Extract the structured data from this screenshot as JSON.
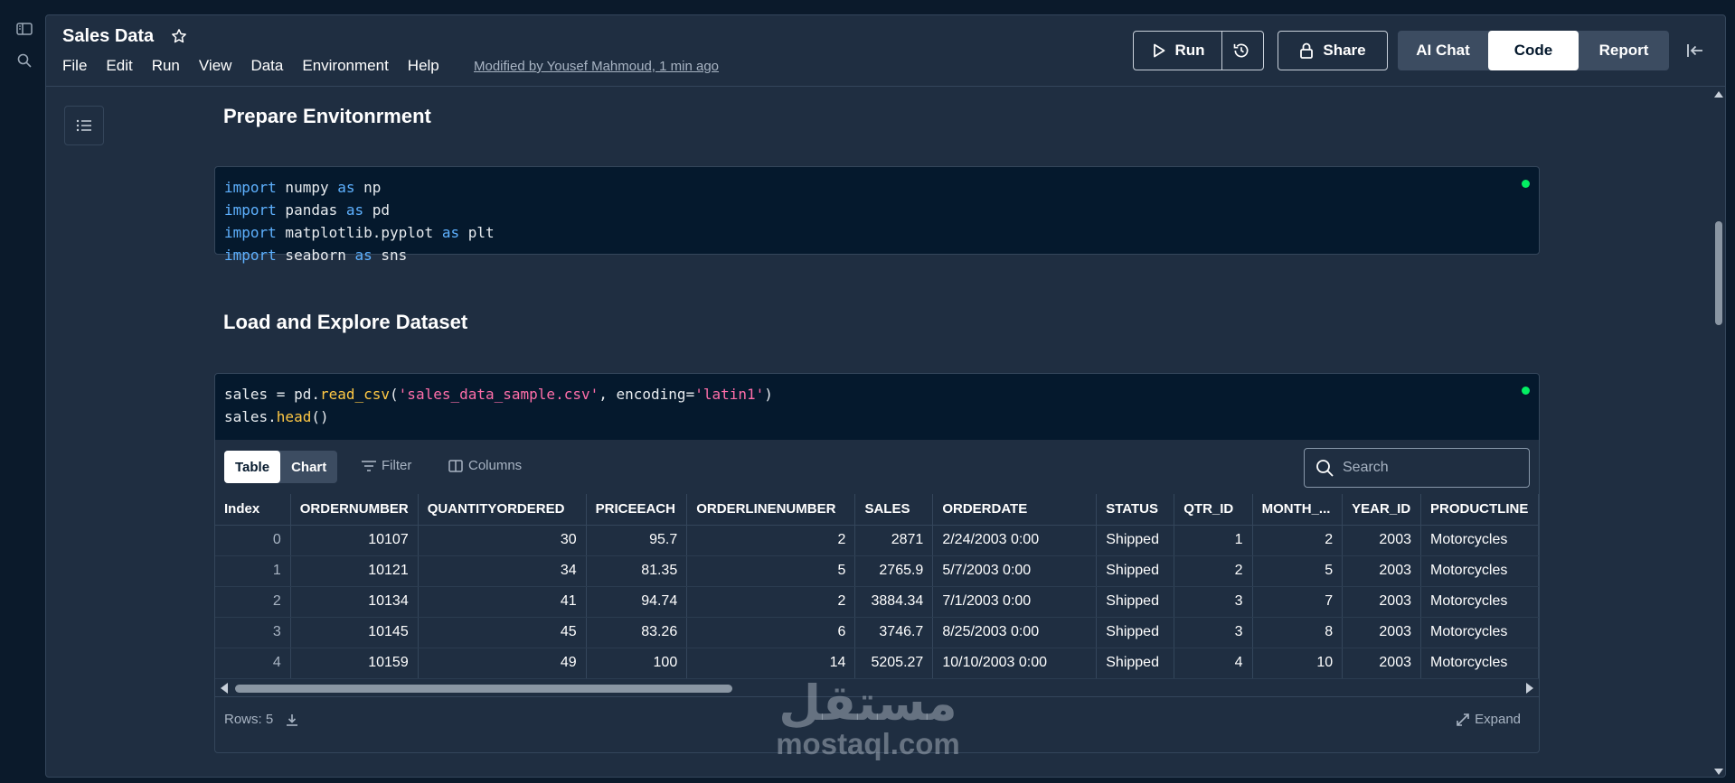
{
  "header": {
    "title": "Sales Data",
    "menu": [
      "File",
      "Edit",
      "Run",
      "View",
      "Data",
      "Environment",
      "Help"
    ],
    "modified": "Modified by Yousef Mahmoud, 1 min ago",
    "run_label": "Run",
    "share_label": "Share",
    "modes": [
      "AI Chat",
      "Code",
      "Report"
    ],
    "active_mode": "Code"
  },
  "sections": {
    "env_heading": "Prepare Envitonrment",
    "load_heading": "Load and Explore Dataset"
  },
  "cell1": {
    "lines": [
      [
        "import",
        " numpy ",
        "as",
        " np"
      ],
      [
        "import",
        " pandas ",
        "as",
        " pd"
      ],
      [
        "import",
        " matplotlib.pyplot ",
        "as",
        " plt"
      ],
      [
        "import",
        " seaborn ",
        "as",
        " sns"
      ]
    ]
  },
  "cell2": {
    "line1": {
      "a": "sales = pd.",
      "fn": "read_csv",
      "b": "(",
      "s1": "'sales_data_sample.csv'",
      "c": ", encoding=",
      "s2": "'latin1'",
      "d": ")"
    },
    "line2": {
      "a": "sales.",
      "fn": "head",
      "b": "()"
    }
  },
  "output": {
    "tabs": [
      "Table",
      "Chart"
    ],
    "active_tab": "Table",
    "filter_label": "Filter",
    "columns_label": "Columns",
    "search_placeholder": "Search",
    "rows_label": "Rows: 5",
    "expand_label": "Expand",
    "table": {
      "headers": [
        "Index",
        "ORDERNUMBER",
        "QUANTITYORDERED",
        "PRICEEACH",
        "ORDERLINENUMBER",
        "SALES",
        "ORDERDATE",
        "STATUS",
        "QTR_ID",
        "MONTH_...",
        "YEAR_ID",
        "PRODUCTLINE"
      ],
      "rows": [
        [
          "0",
          "10107",
          "30",
          "95.7",
          "2",
          "2871",
          "2/24/2003 0:00",
          "Shipped",
          "1",
          "2",
          "2003",
          "Motorcycles"
        ],
        [
          "1",
          "10121",
          "34",
          "81.35",
          "5",
          "2765.9",
          "5/7/2003 0:00",
          "Shipped",
          "2",
          "5",
          "2003",
          "Motorcycles"
        ],
        [
          "2",
          "10134",
          "41",
          "94.74",
          "2",
          "3884.34",
          "7/1/2003 0:00",
          "Shipped",
          "3",
          "7",
          "2003",
          "Motorcycles"
        ],
        [
          "3",
          "10145",
          "45",
          "83.26",
          "6",
          "3746.7",
          "8/25/2003 0:00",
          "Shipped",
          "3",
          "8",
          "2003",
          "Motorcycles"
        ],
        [
          "4",
          "10159",
          "49",
          "100",
          "14",
          "5205.27",
          "10/10/2003 0:00",
          "Shipped",
          "4",
          "10",
          "2003",
          "Motorcycles"
        ]
      ]
    }
  },
  "watermark": {
    "arabic": "مستقل",
    "latin": "mostaql.com"
  },
  "colors": {
    "background": "#0b1a2b",
    "panel": "#1f2e41",
    "code_bg": "#05192d",
    "keyword": "#5eb1ff",
    "function": "#ffc844",
    "string": "#ff6ea9",
    "status_dot": "#03ef62"
  }
}
